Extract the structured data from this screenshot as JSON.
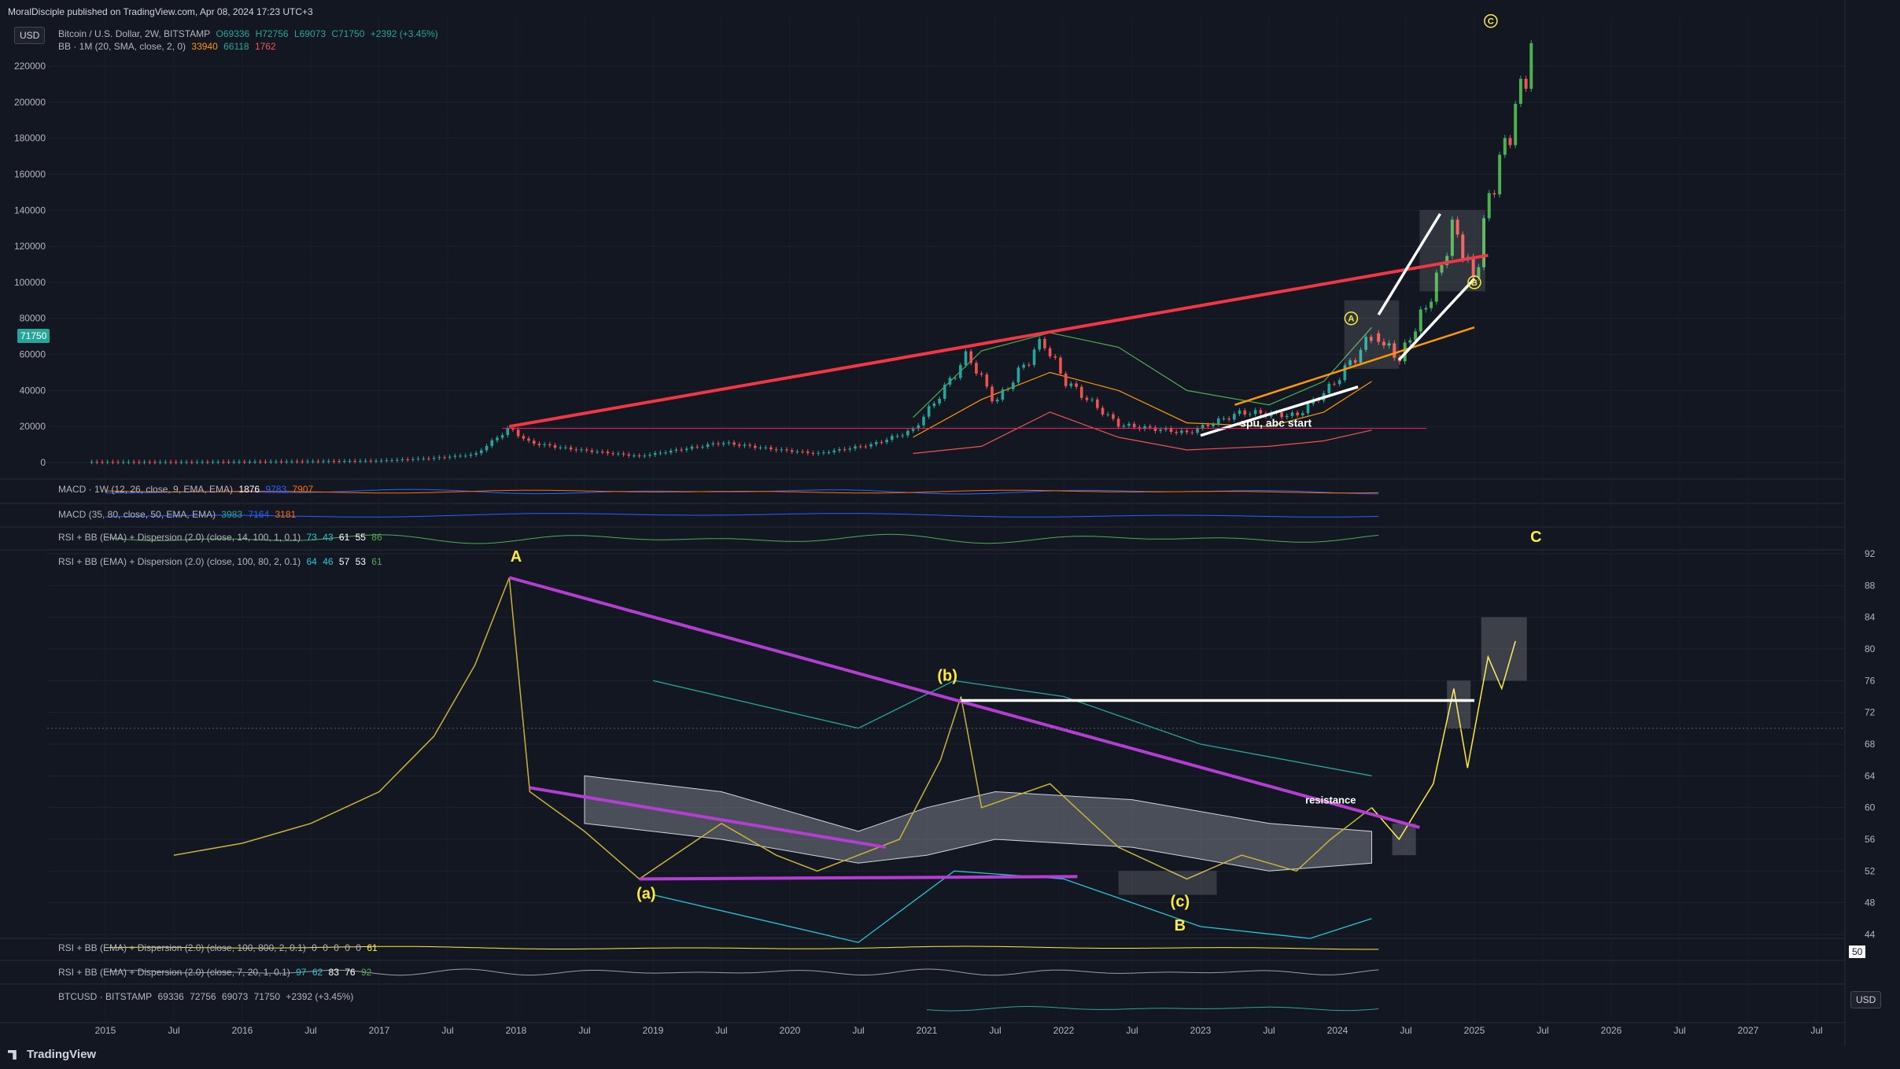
{
  "header": {
    "published_by": "MoralDisciple published on TradingView.com, Apr 08, 2024 17:23 UTC+3",
    "currency": "USD"
  },
  "legend": {
    "symbol": "Bitcoin / U.S. Dollar, 2W, BITSTAMP",
    "open": "O69336",
    "high": "H72756",
    "low": "L69073",
    "close": "C71750",
    "change": "+2392 (+3.45%)",
    "bb_label": "BB · 1M (20, SMA, close, 2, 0)",
    "bb_v1": "33940",
    "bb_v2": "66118",
    "bb_v3": "1762",
    "macd1_label": "MACD · 1W (12, 26, close, 9, EMA, EMA)",
    "macd1_v1": "1876",
    "macd1_v2": "9783",
    "macd1_v3": "7907",
    "macd2_label": "MACD (35, 80, close, 50, EMA, EMA)",
    "macd2_v1": "3983",
    "macd2_v2": "7164",
    "macd2_v3": "3181",
    "rsi1_label": "RSI + BB (EMA) + Dispersion (2.0) (close, 14, 100, 1, 0.1)",
    "rsi1_vals": [
      "73",
      "43",
      "61",
      "55",
      "86"
    ],
    "rsi2_label": "RSI + BB (EMA) + Dispersion (2.0) (close, 100, 80, 2, 0.1)",
    "rsi2_vals": [
      "64",
      "46",
      "57",
      "53",
      "61"
    ],
    "rsi3_label": "RSI + BB (EMA) + Dispersion (2.0) (close, 100, 800, 2, 0.1)",
    "rsi3_vals": [
      "0",
      "0",
      "0",
      "0",
      "0",
      "61"
    ],
    "rsi4_label": "RSI + BB (EMA) + Dispersion (2.0) (close, 7, 20, 1, 0.1)",
    "rsi4_vals": [
      "97",
      "62",
      "83",
      "76",
      "92"
    ],
    "btc_label": "BTCUSD · BITSTAMP",
    "btc_vals": [
      "69336",
      "72756",
      "69073",
      "71750",
      "+2392 (+3.45%)"
    ]
  },
  "price_badge": "71750",
  "right_usd": "USD",
  "right_50": "50",
  "footer_brand": "TradingView",
  "colors": {
    "bg": "#131722",
    "grid": "#1f2330",
    "bull": "#26a69a",
    "bear": "#ef5350",
    "red_trend": "#f23645",
    "purple": "#b33ed1",
    "yellow": "#ffeb3b",
    "rsi_line": "#c8b23a",
    "teal": "#26a69a",
    "orange": "#ff9800",
    "white": "#ffffff"
  },
  "chart_data": [
    {
      "type": "candlestick",
      "title": "Bitcoin / U.S. Dollar, 2W, BITSTAMP",
      "xlabel": "",
      "ylabel": "",
      "x_ticks": [
        "2015",
        "Jul",
        "2016",
        "Jul",
        "2017",
        "Jul",
        "2018",
        "Jul",
        "2019",
        "Jul",
        "2020",
        "Jul",
        "2021",
        "Jul",
        "2022",
        "Jul",
        "2023",
        "Jul",
        "2024",
        "Jul",
        "2025",
        "Jul",
        "2026",
        "Jul",
        "2027",
        "Jul"
      ],
      "y_ticks": [
        0,
        20000,
        40000,
        60000,
        80000,
        100000,
        120000,
        140000,
        160000,
        180000,
        200000,
        220000
      ],
      "ylim": [
        -5000,
        235000
      ],
      "price_path": [
        {
          "t": 2014.9,
          "v": 300
        },
        {
          "t": 2015.5,
          "v": 250
        },
        {
          "t": 2016.0,
          "v": 420
        },
        {
          "t": 2016.5,
          "v": 650
        },
        {
          "t": 2017.0,
          "v": 1000
        },
        {
          "t": 2017.4,
          "v": 2500
        },
        {
          "t": 2017.7,
          "v": 4500
        },
        {
          "t": 2017.95,
          "v": 19000
        },
        {
          "t": 2018.1,
          "v": 11000
        },
        {
          "t": 2018.4,
          "v": 7500
        },
        {
          "t": 2018.9,
          "v": 3500
        },
        {
          "t": 2019.5,
          "v": 11000
        },
        {
          "t": 2019.9,
          "v": 7200
        },
        {
          "t": 2020.2,
          "v": 5000
        },
        {
          "t": 2020.6,
          "v": 10000
        },
        {
          "t": 2020.9,
          "v": 18000
        },
        {
          "t": 2021.1,
          "v": 38000
        },
        {
          "t": 2021.3,
          "v": 60000
        },
        {
          "t": 2021.5,
          "v": 33000
        },
        {
          "t": 2021.85,
          "v": 68000
        },
        {
          "t": 2022.0,
          "v": 46000
        },
        {
          "t": 2022.4,
          "v": 21000
        },
        {
          "t": 2022.9,
          "v": 16500
        },
        {
          "t": 2023.3,
          "v": 28000
        },
        {
          "t": 2023.7,
          "v": 26000
        },
        {
          "t": 2023.95,
          "v": 42000
        },
        {
          "t": 2024.27,
          "v": 71750
        }
      ],
      "projection_path": [
        {
          "t": 2024.27,
          "v": 71750
        },
        {
          "t": 2024.45,
          "v": 57000
        },
        {
          "t": 2024.7,
          "v": 95000
        },
        {
          "t": 2024.85,
          "v": 132000
        },
        {
          "t": 2025.0,
          "v": 100000
        },
        {
          "t": 2025.1,
          "v": 145000
        },
        {
          "t": 2025.3,
          "v": 195000
        },
        {
          "t": 2025.45,
          "v": 240000
        }
      ],
      "bb_upper": [
        {
          "t": 2020.9,
          "v": 25000
        },
        {
          "t": 2021.4,
          "v": 62000
        },
        {
          "t": 2021.9,
          "v": 72000
        },
        {
          "t": 2022.4,
          "v": 64000
        },
        {
          "t": 2022.9,
          "v": 40000
        },
        {
          "t": 2023.5,
          "v": 32000
        },
        {
          "t": 2023.9,
          "v": 45000
        },
        {
          "t": 2024.25,
          "v": 75000
        }
      ],
      "bb_lower": [
        {
          "t": 2020.9,
          "v": 5000
        },
        {
          "t": 2021.4,
          "v": 9000
        },
        {
          "t": 2021.9,
          "v": 28000
        },
        {
          "t": 2022.4,
          "v": 14000
        },
        {
          "t": 2022.9,
          "v": 7000
        },
        {
          "t": 2023.5,
          "v": 9000
        },
        {
          "t": 2023.9,
          "v": 12000
        },
        {
          "t": 2024.25,
          "v": 18000
        }
      ],
      "bb_basis": [
        {
          "t": 2020.9,
          "v": 14000
        },
        {
          "t": 2021.4,
          "v": 35000
        },
        {
          "t": 2021.9,
          "v": 50000
        },
        {
          "t": 2022.4,
          "v": 40000
        },
        {
          "t": 2022.9,
          "v": 22000
        },
        {
          "t": 2023.5,
          "v": 20000
        },
        {
          "t": 2023.9,
          "v": 28000
        },
        {
          "t": 2024.25,
          "v": 45000
        }
      ],
      "red_trendline": [
        {
          "t": 2017.95,
          "v": 20000
        },
        {
          "t": 2025.1,
          "v": 115000
        }
      ],
      "white_channel": [
        [
          {
            "t": 2023.0,
            "v": 15000
          },
          {
            "t": 2024.15,
            "v": 42000
          }
        ],
        [
          {
            "t": 2024.3,
            "v": 82000
          },
          {
            "t": 2024.75,
            "v": 138000
          }
        ],
        [
          {
            "t": 2024.45,
            "v": 57000
          },
          {
            "t": 2025.0,
            "v": 102000
          }
        ]
      ],
      "orange_line": [
        {
          "t": 2023.25,
          "v": 32000
        },
        {
          "t": 2025.0,
          "v": 75000
        }
      ],
      "annotations": [
        {
          "text": "spu, abc start",
          "t": 2023.55,
          "v": 22000
        },
        {
          "text": "A",
          "t": 2024.1,
          "v": 80000
        },
        {
          "text": "B",
          "t": 2025.0,
          "v": 100000
        },
        {
          "text": "C",
          "t": 2025.12,
          "v": 245000
        }
      ]
    },
    {
      "type": "line",
      "title": "RSI + BB (EMA) + Dispersion (2.0) (close, 100, 80, 2, 0.1)",
      "xlabel": "",
      "ylabel": "",
      "y_ticks": [
        44,
        48,
        52,
        56,
        60,
        64,
        68,
        72,
        76,
        80,
        84,
        88,
        92
      ],
      "ylim": [
        42,
        93
      ],
      "rsi_path": [
        {
          "t": 2015.5,
          "v": 54
        },
        {
          "t": 2016.0,
          "v": 55.5
        },
        {
          "t": 2016.5,
          "v": 58
        },
        {
          "t": 2017.0,
          "v": 62
        },
        {
          "t": 2017.4,
          "v": 69
        },
        {
          "t": 2017.7,
          "v": 78
        },
        {
          "t": 2017.95,
          "v": 89
        },
        {
          "t": 2018.1,
          "v": 62
        },
        {
          "t": 2018.5,
          "v": 57
        },
        {
          "t": 2018.9,
          "v": 51
        },
        {
          "t": 2019.5,
          "v": 58
        },
        {
          "t": 2019.9,
          "v": 54
        },
        {
          "t": 2020.2,
          "v": 52
        },
        {
          "t": 2020.8,
          "v": 56
        },
        {
          "t": 2021.1,
          "v": 66
        },
        {
          "t": 2021.25,
          "v": 74
        },
        {
          "t": 2021.4,
          "v": 60
        },
        {
          "t": 2021.9,
          "v": 63
        },
        {
          "t": 2022.4,
          "v": 55
        },
        {
          "t": 2022.9,
          "v": 51
        },
        {
          "t": 2023.3,
          "v": 54
        },
        {
          "t": 2023.7,
          "v": 52
        },
        {
          "t": 2023.95,
          "v": 56
        },
        {
          "t": 2024.25,
          "v": 60
        }
      ],
      "rsi_projection": [
        {
          "t": 2024.25,
          "v": 60
        },
        {
          "t": 2024.45,
          "v": 56
        },
        {
          "t": 2024.7,
          "v": 63
        },
        {
          "t": 2024.85,
          "v": 75
        },
        {
          "t": 2024.95,
          "v": 65
        },
        {
          "t": 2025.1,
          "v": 79
        },
        {
          "t": 2025.2,
          "v": 75
        },
        {
          "t": 2025.3,
          "v": 81
        }
      ],
      "band_upper": [
        {
          "t": 2018.5,
          "v": 64
        },
        {
          "t": 2019.5,
          "v": 62
        },
        {
          "t": 2020.5,
          "v": 57
        },
        {
          "t": 2021.0,
          "v": 60
        },
        {
          "t": 2021.5,
          "v": 62
        },
        {
          "t": 2022.5,
          "v": 61
        },
        {
          "t": 2023.5,
          "v": 58
        },
        {
          "t": 2024.25,
          "v": 57
        }
      ],
      "band_lower": [
        {
          "t": 2018.5,
          "v": 58
        },
        {
          "t": 2019.5,
          "v": 56
        },
        {
          "t": 2020.5,
          "v": 53
        },
        {
          "t": 2021.0,
          "v": 54
        },
        {
          "t": 2021.5,
          "v": 56
        },
        {
          "t": 2022.5,
          "v": 55
        },
        {
          "t": 2023.5,
          "v": 52
        },
        {
          "t": 2024.25,
          "v": 53
        }
      ],
      "outer_upper": [
        {
          "t": 2019.0,
          "v": 76
        },
        {
          "t": 2020.5,
          "v": 70
        },
        {
          "t": 2021.2,
          "v": 76
        },
        {
          "t": 2022.0,
          "v": 74
        },
        {
          "t": 2023.0,
          "v": 68
        },
        {
          "t": 2024.25,
          "v": 64
        }
      ],
      "outer_lower": [
        {
          "t": 2019.0,
          "v": 49
        },
        {
          "t": 2020.5,
          "v": 43
        },
        {
          "t": 2021.2,
          "v": 52
        },
        {
          "t": 2022.0,
          "v": 51
        },
        {
          "t": 2023.0,
          "v": 45
        },
        {
          "t": 2023.8,
          "v": 43.5
        },
        {
          "t": 2024.25,
          "v": 46
        }
      ],
      "purple_lines": [
        [
          {
            "t": 2017.95,
            "v": 89
          },
          {
            "t": 2024.6,
            "v": 57.5
          }
        ],
        [
          {
            "t": 2018.1,
            "v": 62.5
          },
          {
            "t": 2020.7,
            "v": 55
          }
        ],
        [
          {
            "t": 2018.9,
            "v": 51
          },
          {
            "t": 2022.1,
            "v": 51.3
          }
        ]
      ],
      "white_level": [
        {
          "t": 2021.25,
          "v": 73.5
        },
        {
          "t": 2025.0,
          "v": 73.5
        }
      ],
      "labels": [
        {
          "text": "A",
          "t": 2018.0,
          "v": 91
        },
        {
          "text": "(b)",
          "t": 2021.15,
          "v": 76
        },
        {
          "text": "(a)",
          "t": 2018.95,
          "v": 48.5
        },
        {
          "text": "(c)",
          "t": 2022.85,
          "v": 47.5
        },
        {
          "text": "B",
          "t": 2022.85,
          "v": 44.5
        },
        {
          "text": "C",
          "t": 2025.45,
          "v": 93.5
        },
        {
          "text": "resistance",
          "t": 2023.95,
          "v": 60.5
        }
      ]
    }
  ]
}
